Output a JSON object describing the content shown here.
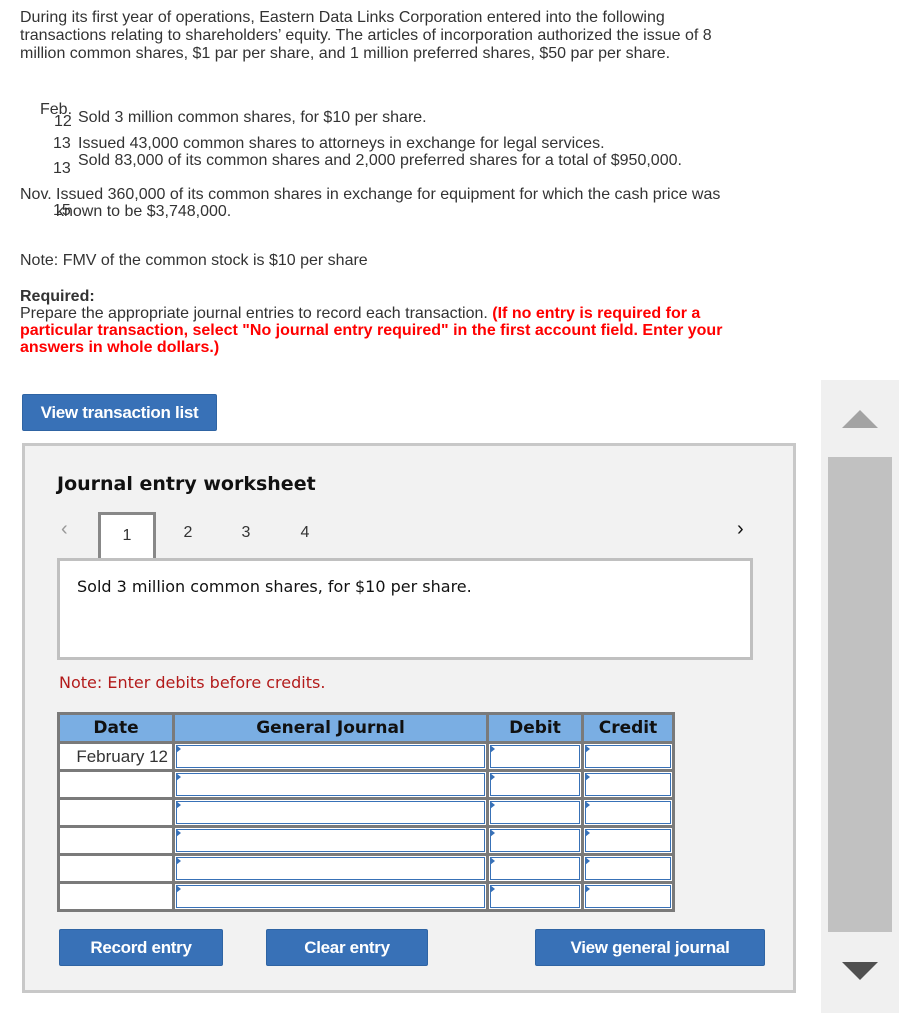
{
  "problem": {
    "intro": "During its first year of operations, Eastern Data Links Corporation entered into the following transactions relating to shareholders’ equity. The articles of incorporation authorized the issue of 8 million common shares, $1 par per share, and 1 million preferred shares, $50 par per share.",
    "transactions": [
      {
        "date_month": "Feb.",
        "date_day": "12",
        "text": "Sold 3 million common shares, for $10 per share."
      },
      {
        "date_month": "",
        "date_day": "13",
        "text": "Issued 43,000 common shares to attorneys in exchange for legal services."
      },
      {
        "date_month": "",
        "date_day": "13",
        "text": "Sold 83,000 of its common shares and 2,000 preferred shares for a total of $950,000."
      },
      {
        "date_month": "Nov.",
        "date_day": "15",
        "text": "Issued 360,000 of its common shares in exchange for equipment for which the cash price was known to be $3,748,000."
      }
    ],
    "note_fmv": "Note: FMV of the common stock is $10 per share",
    "required_label": "Required:",
    "required_text": "Prepare the appropriate journal entries to record each transaction. ",
    "required_instruction": "(If no entry is required for a particular transaction, select \"No journal entry required\" in the first account field. Enter your answers in whole dollars.)"
  },
  "buttons": {
    "view_transaction_list": "View transaction list",
    "record_entry": "Record entry",
    "clear_entry": "Clear entry",
    "view_general_journal": "View general journal"
  },
  "worksheet": {
    "title": "Journal entry worksheet",
    "pages": [
      "1",
      "2",
      "3",
      "4"
    ],
    "active_page": "1",
    "prev_icon": "‹",
    "next_icon": "›",
    "transaction_description": "Sold 3 million common shares, for $10 per share.",
    "note": "Note: Enter debits before credits.",
    "table": {
      "headers": [
        "Date",
        "General Journal",
        "Debit",
        "Credit"
      ],
      "rows": [
        {
          "date": "February 12",
          "account": "",
          "debit": "",
          "credit": ""
        },
        {
          "date": "",
          "account": "",
          "debit": "",
          "credit": ""
        },
        {
          "date": "",
          "account": "",
          "debit": "",
          "credit": ""
        },
        {
          "date": "",
          "account": "",
          "debit": "",
          "credit": ""
        },
        {
          "date": "",
          "account": "",
          "debit": "",
          "credit": ""
        },
        {
          "date": "",
          "account": "",
          "debit": "",
          "credit": ""
        }
      ]
    }
  },
  "colors": {
    "button_blue": "#3871b7",
    "header_blue": "#7aaee3",
    "instruction_red": "#ff0000",
    "note_red": "#b31b1b"
  }
}
